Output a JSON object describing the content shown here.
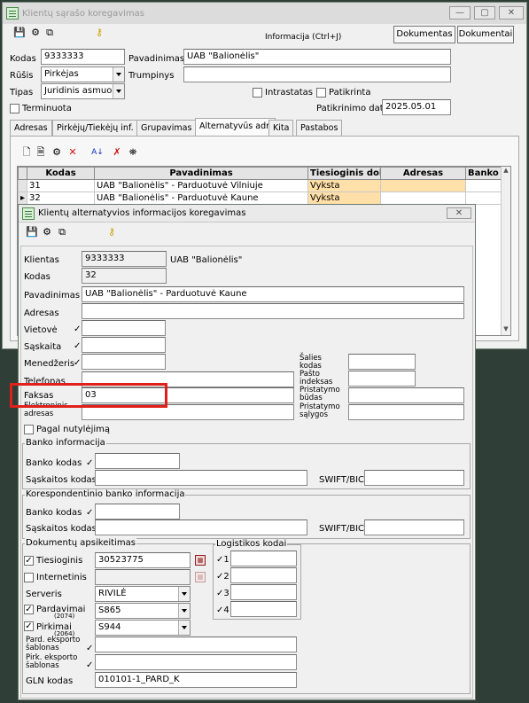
{
  "bg_win": {
    "title": "Klientų sąrašo koregavimas",
    "toolbar_caption": "Informacija (Ctrl+J)",
    "btn_documents": "Dokumentas",
    "btn_documents2": "Dokumentai",
    "kodas_label": "Kodas",
    "kodas_value": "9333333",
    "pavadinimas_label": "Pavadinimas",
    "pavadinimas_value": "UAB \"Balionėlis\"",
    "rusis_label": "Rūšis",
    "rusis_value": "Pirkėjas",
    "trumpinys_label": "Trumpinys",
    "tipas_label": "Tipas",
    "tipas_value": "Juridinis asmuo",
    "intrastatas_label": "Intrastatas",
    "patikrinta_label": "Patikrinta",
    "terminuota_label": "Terminuota",
    "patikrinimo_data_label": "Patikrinimo data",
    "patikrinimo_data_value": "2025.05.01",
    "tabs": [
      "Adresas",
      "Pirkėjų/Tiekėjų inf.",
      "Grupavimas",
      "Alternatyvūs adr.",
      "Kita",
      "Pastabos"
    ],
    "selected_tab": "Alternatyvūs adr.",
    "grid": {
      "columns": [
        "Kodas",
        "Pavadinimas",
        "Tiesioginis dok.ap",
        "Adresas",
        "Banko k"
      ],
      "rows": [
        {
          "kodas": "31",
          "pavadinimas": "UAB \"Balionėlis\" - Parduotuvė Vilniuje",
          "tiesioginis": "Vyksta",
          "adresas": "",
          "banko": ""
        },
        {
          "kodas": "32",
          "pavadinimas": "UAB \"Balionėlis\" - Parduotuvė  Kaune",
          "tiesioginis": "Vyksta",
          "adresas": "",
          "banko": ""
        }
      ]
    }
  },
  "dialog": {
    "title": "Klientų alternatyvios informacijos koregavimas",
    "klientas_label": "Klientas",
    "klientas_code": "9333333",
    "klientas_name": "UAB \"Balionėlis\"",
    "kodas_label": "Kodas",
    "kodas_value": "32",
    "pavadinimas_label": "Pavadinimas",
    "pavadinimas_value": "UAB \"Balionėlis\" - Parduotuvė  Kaune",
    "adresas_label": "Adresas",
    "adresas_value": "",
    "vietove_label": "Vietovė",
    "saskaita_label": "Sąskaita",
    "menedzeris_label": "Menedžeris",
    "telefonas_label": "Telefonas",
    "faksas_label": "Faksas",
    "faksas_value": "03",
    "elektroninis_label": "Elektroninis adresas",
    "salies_kodas_label": "Šalies kodas",
    "pasto_indeksas_label": "Pašto indeksas",
    "pristatymo_budas_label": "Pristatymo būdas",
    "pristatymo_salygos_label": "Pristatymo sąlygos",
    "pagal_nutylejima_label": "Pagal nutylėjimą",
    "banko_info": {
      "title": "Banko informacija",
      "banko_kodas_label": "Banko kodas",
      "saskaitos_kodas_label": "Sąskaitos kodas",
      "swift_label": "SWIFT/BIC"
    },
    "koresp_banko_info": {
      "title": "Korespondentinio banko informacija",
      "banko_kodas_label": "Banko kodas",
      "saskaitos_kodas_label": "Sąskaitos kodas",
      "swift_label": "SWIFT/BIC"
    },
    "dokumentu": {
      "title": "Dokumentų apsikeitimas",
      "tiesioginis_label": "Tiesioginis",
      "tiesioginis_value": "30523775",
      "tiesioginis_checked": true,
      "internetinis_label": "Internetinis",
      "internetinis_checked": false,
      "serveris_label": "Serveris",
      "serveris_value": "RIVILĖ",
      "pardavimai_label": "Pardavimai",
      "pardavimai_code": "(2074)",
      "pardavimai_value": "S865",
      "pardavimai_checked": true,
      "pirkimai_label": "Pirkimai",
      "pirkimai_code": "(2064)",
      "pirkimai_value": "S944",
      "pirkimai_checked": true,
      "pard_eksporto_label": "Pard. eksporto šablonas",
      "pirk_eksporto_label": "Pirk. eksporto šablonas",
      "gln_label": "GLN kodas",
      "gln_value": "010101-1_PARD_K"
    },
    "logistikos": {
      "title": "Logistikos kodai",
      "numbers": [
        "1",
        "2",
        "3",
        "4"
      ]
    },
    "tick": "✓"
  },
  "colors": {
    "highlight_box": "#e0201a",
    "tiesioginis_cell": "#ffe0a8"
  }
}
